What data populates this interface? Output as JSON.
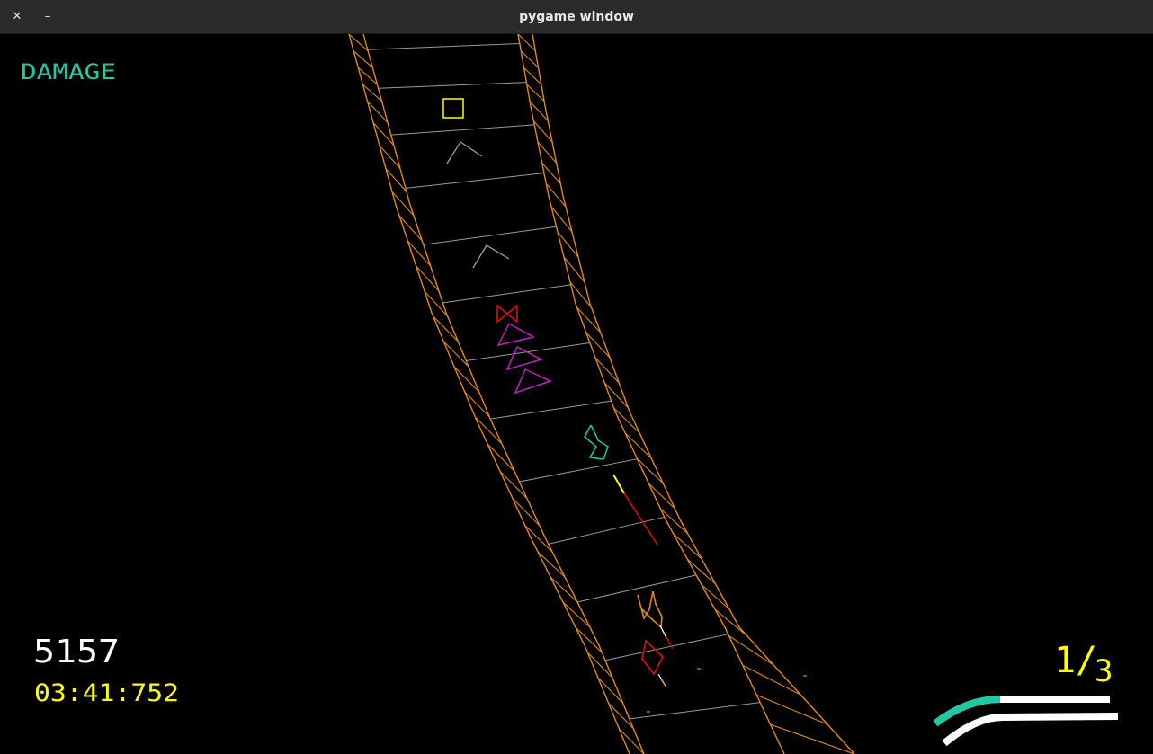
{
  "window": {
    "title": "pygame window",
    "close_glyph": "✕",
    "minimize_glyph": "–"
  },
  "hud": {
    "damage_label": "DAMAGE",
    "score": "5157",
    "timer": "03:41:752",
    "lap": {
      "current": "1",
      "separator": "/",
      "total": "3"
    },
    "track_progress": 0.38
  },
  "colors": {
    "track_edge": "#e08a1e",
    "track_rung": "#9a9a9a",
    "damage_label": "#1fc9a3",
    "score": "#ffffff",
    "timer": "#ffff00",
    "lap": "#ffff00",
    "progress_fill": "#1fc9a3",
    "progress_track": "#ffffff",
    "enemy_triangle": "#c020c0",
    "enemy_bowtie": "#e01010",
    "enemy_box": "#ffff00",
    "enemy_ghost": "#a0a0a0",
    "player_ship": "#e08a1e",
    "rival_ship": "#e01010",
    "rival_cyan": "#1fc9a3"
  },
  "icons": {
    "close": "close-icon",
    "minimize": "minimize-icon"
  }
}
